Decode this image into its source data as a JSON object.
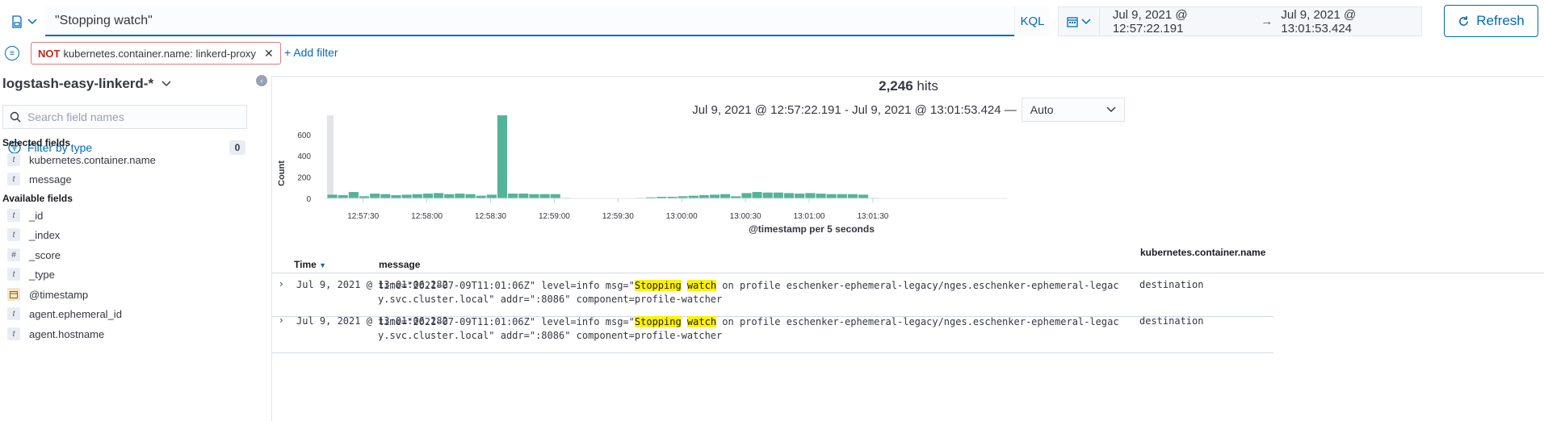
{
  "query": {
    "text": "\"Stopping watch\"",
    "language": "KQL"
  },
  "time_range": {
    "start": "Jul 9, 2021 @ 12:57:22.191",
    "end": "Jul 9, 2021 @ 13:01:53.424"
  },
  "refresh_label": "Refresh",
  "filters": [
    {
      "negate_label": "NOT",
      "field": "kubernetes.container.name",
      "value": "linkerd-proxy"
    }
  ],
  "add_filter_label": "+ Add filter",
  "sidebar": {
    "index_pattern": "logstash-easy-linkerd-*",
    "search_placeholder": "Search field names",
    "filter_by_type_label": "Filter by type",
    "filter_by_type_count": "0",
    "selected_title": "Selected fields",
    "selected_fields": [
      {
        "type": "t",
        "name": "kubernetes.container.name"
      },
      {
        "type": "t",
        "name": "message"
      }
    ],
    "available_title": "Available fields",
    "available_fields": [
      {
        "type": "t",
        "name": "_id"
      },
      {
        "type": "t",
        "name": "_index"
      },
      {
        "type": "#",
        "name": "_score"
      },
      {
        "type": "t",
        "name": "_type"
      },
      {
        "type": "date",
        "name": "@timestamp"
      },
      {
        "type": "t",
        "name": "agent.ephemeral_id"
      },
      {
        "type": "t",
        "name": "agent.hostname"
      }
    ]
  },
  "histogram": {
    "hits_count": "2,246",
    "hits_label": "hits",
    "range_text": "Jul 9, 2021 @ 12:57:22.191 - Jul 9, 2021 @ 13:01:53.424 —",
    "interval": "Auto"
  },
  "chart_data": {
    "type": "bar",
    "xlabel": "@timestamp per 5 seconds",
    "ylabel": "Count",
    "ylim": [
      0,
      780
    ],
    "yticks": [
      0,
      200,
      400,
      600
    ],
    "xticks": [
      "12:57:30",
      "12:58:00",
      "12:58:30",
      "12:59:00",
      "12:59:30",
      "13:00:00",
      "13:00:30",
      "13:01:00",
      "13:01:30"
    ],
    "bar_color": "#54b399",
    "values": [
      35,
      30,
      60,
      20,
      45,
      40,
      30,
      35,
      40,
      45,
      50,
      40,
      45,
      40,
      25,
      35,
      780,
      45,
      45,
      40,
      40,
      40,
      5,
      0,
      0,
      0,
      0,
      0,
      0,
      5,
      10,
      15,
      15,
      20,
      25,
      30,
      35,
      40,
      20,
      50,
      60,
      55,
      55,
      50,
      45,
      50,
      45,
      40,
      40,
      40,
      35,
      5,
      0,
      0,
      0,
      0,
      0,
      0,
      0,
      0,
      0
    ]
  },
  "table": {
    "columns": [
      "Time",
      "message",
      "kubernetes.container.name"
    ],
    "rows": [
      {
        "time": "Jul 9, 2021 @ 13:01:06.282",
        "msg_before": "time=\"2021-07-09T11:01:06Z\" level=info msg=\"",
        "hl1": "Stopping",
        "hl2": "watch",
        "msg_after": " on profile eschenker-ephemeral-legacy/nges.eschenker-ephemeral-legacy.svc.cluster.local\" addr=\":8086\" component=profile-watcher",
        "container": "destination"
      },
      {
        "time": "Jul 9, 2021 @ 13:01:06.282",
        "msg_before": "time=\"2021-07-09T11:01:06Z\" level=info msg=\"",
        "hl1": "Stopping",
        "hl2": "watch",
        "msg_after": " on profile eschenker-ephemeral-legacy/nges.eschenker-ephemeral-legacy.svc.cluster.local\" addr=\":8086\" component=profile-watcher",
        "container": "destination"
      }
    ]
  }
}
